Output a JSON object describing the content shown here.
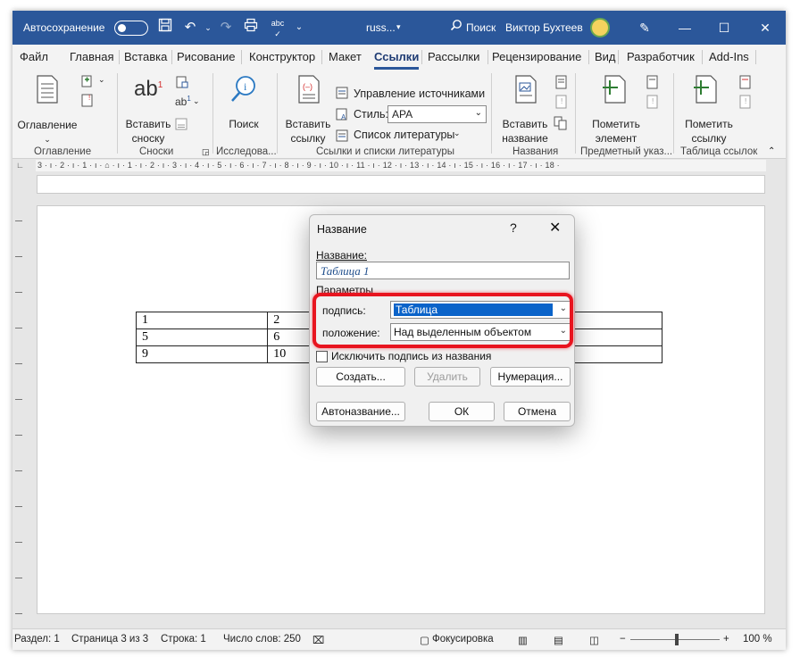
{
  "titlebar": {
    "autosave_label": "Автосохранение",
    "doc_name": "russ...",
    "search_placeholder": "Поиск",
    "user_name": "Виктор Бухтеев",
    "bg_color": "#2b579a"
  },
  "tabs": [
    {
      "label": "Файл"
    },
    {
      "label": "Главная"
    },
    {
      "label": "Вставка"
    },
    {
      "label": "Рисование"
    },
    {
      "label": "Конструктор"
    },
    {
      "label": "Макет"
    },
    {
      "label": "Ссылки"
    },
    {
      "label": "Рассылки"
    },
    {
      "label": "Рецензирование"
    },
    {
      "label": "Вид"
    },
    {
      "label": "Разработчик"
    },
    {
      "label": "Add-Ins"
    }
  ],
  "active_tab": "Ссылки",
  "ribbon": {
    "toc": {
      "button_line1": "Оглавление",
      "group": "Оглавление"
    },
    "footnotes": {
      "button_line1": "Вставить",
      "button_line2": "сноску",
      "group": "Сноски"
    },
    "research": {
      "button": "Поиск",
      "group": "Исследова..."
    },
    "citations": {
      "button_line1": "Вставить",
      "button_line2": "ссылку",
      "manage_sources": "Управление источниками",
      "style_label": "Стиль:",
      "style_value": "APA",
      "bibliography": "Список литературы",
      "group": "Ссылки и списки литературы"
    },
    "captions": {
      "button_line1": "Вставить",
      "button_line2": "название",
      "group": "Названия"
    },
    "index": {
      "button_line1": "Пометить",
      "button_line2": "элемент",
      "group": "Предметный указ..."
    },
    "toa": {
      "button_line1": "Пометить",
      "button_line2": "ссылку",
      "group": "Таблица ссылок"
    }
  },
  "ruler": {
    "text": "3 · ı · 2 · ı · 1 · ı · ⌂ · ı · 1 · ı · 2 · ı · 3 · ı · 4 · ı · 5 · ı · 6 · ı · 7 · ı · 8 · ı · 9 · ı · 10 · ı · 11 · ı · 12 · ı · 13 · ı · 14 · ı · 15 · ı · 16 · ı · 17 · ı · 18 ·"
  },
  "document_table": {
    "rows": [
      [
        "1",
        "2",
        "",
        ""
      ],
      [
        "5",
        "6",
        "",
        ""
      ],
      [
        "9",
        "10",
        "",
        ""
      ]
    ]
  },
  "dialog": {
    "title": "Название",
    "help": "?",
    "caption_label": "Название:",
    "caption_value": "Таблица 1",
    "params_label": "Параметры",
    "label_label": "подпись:",
    "label_value": "Таблица",
    "position_label": "положение:",
    "position_value": "Над выделенным объектом",
    "exclude_label": "Исключить подпись из названия",
    "exclude_checked": false,
    "new_label_button": "Создать...",
    "delete_label_button": "Удалить",
    "numbering_button": "Нумерация...",
    "autocaption_button": "Автоназвание...",
    "ok_button": "ОК",
    "cancel_button": "Отмена",
    "highlight_color": "#e8141f"
  },
  "statusbar": {
    "section": "Раздел: 1",
    "page": "Страница 3 из 3",
    "line": "Строка: 1",
    "words": "Число слов: 250",
    "focus": "Фокусировка",
    "zoom": "100 %",
    "zoom_minus": "−",
    "zoom_plus": "+"
  }
}
